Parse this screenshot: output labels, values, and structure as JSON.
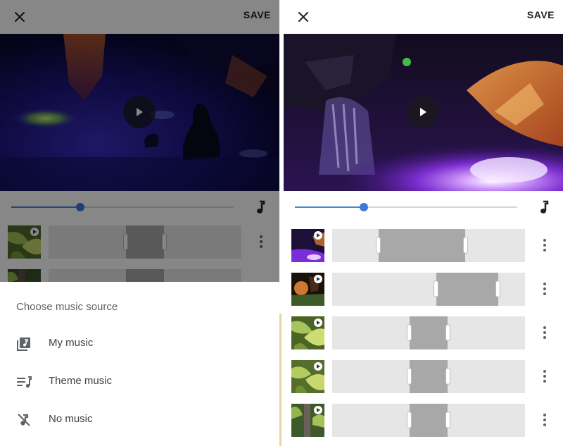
{
  "editor": {
    "save_label": "SAVE",
    "playback_progress": 0.31
  },
  "clips": [
    {
      "thumbnail": "purple-lit waterfall at night",
      "trim_start": 0.24,
      "trim_end": 0.69
    },
    {
      "thumbnail": "night garden with orange light",
      "trim_start": 0.54,
      "trim_end": 0.86
    },
    {
      "thumbnail": "green leaves close-up",
      "trim_start": 0.4,
      "trim_end": 0.6
    },
    {
      "thumbnail": "green leaves close-up",
      "trim_start": 0.4,
      "trim_end": 0.6
    },
    {
      "thumbnail": "tree trunk in foliage",
      "trim_start": 0.4,
      "trim_end": 0.6
    }
  ],
  "left_clips": [
    {
      "trim_start": 0.4,
      "trim_end": 0.6
    },
    {
      "trim_start": 0.4,
      "trim_end": 0.6
    }
  ],
  "music_sheet": {
    "title": "Choose music source",
    "options": [
      {
        "label": "My music",
        "icon": "music-library-icon"
      },
      {
        "label": "Theme music",
        "icon": "playlist-music-icon"
      },
      {
        "label": "No music",
        "icon": "music-off-icon"
      }
    ]
  },
  "colors": {
    "accent": "#3c78d8",
    "scrim": "rgba(0,0,0,0.47)",
    "trim_selected": "#a8a8a8",
    "trim_track": "#e6e6e6"
  }
}
